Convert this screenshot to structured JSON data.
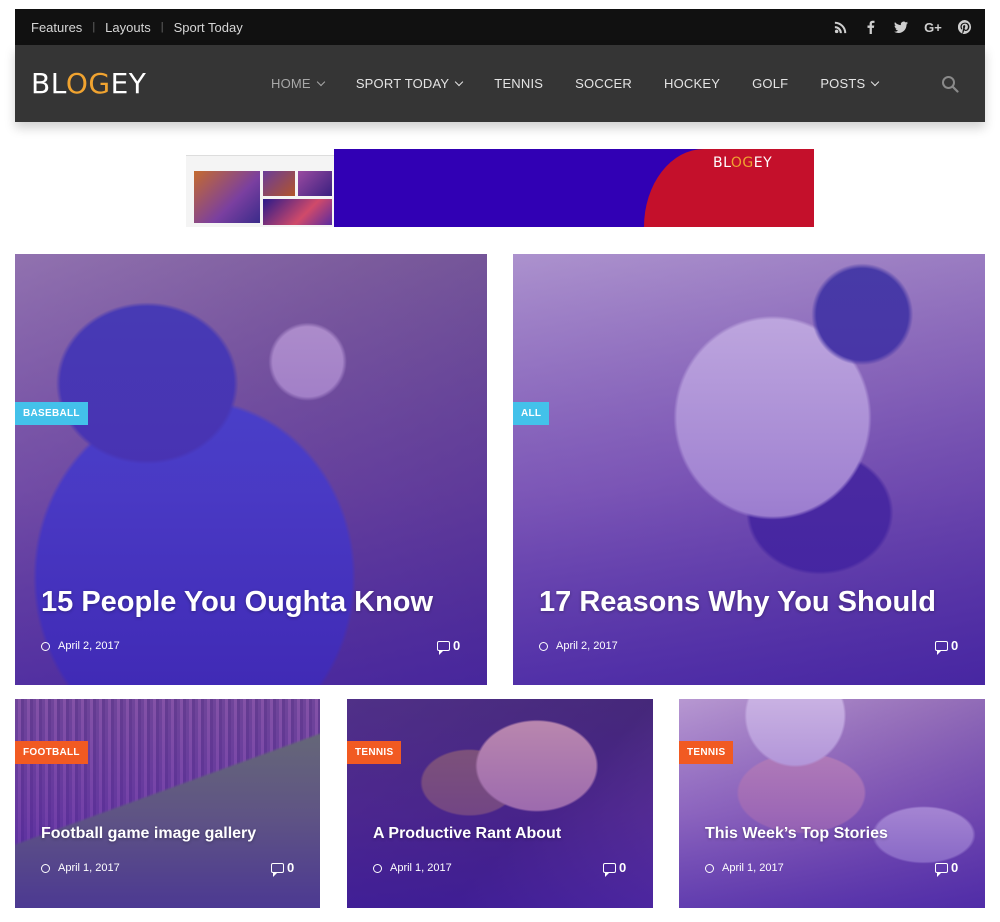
{
  "topbar": {
    "links": [
      "Features",
      "Layouts",
      "Sport Today"
    ],
    "socials": [
      "rss-icon",
      "facebook-icon",
      "twitter-icon",
      "google-plus-icon",
      "pinterest-icon"
    ]
  },
  "header": {
    "logo_prefix": "BL",
    "logo_highlight": "OG",
    "logo_suffix": "EY",
    "menu": [
      {
        "label": "HOME",
        "dropdown": true,
        "active": true
      },
      {
        "label": "SPORT TODAY",
        "dropdown": true
      },
      {
        "label": "TENNIS"
      },
      {
        "label": "SOCCER"
      },
      {
        "label": "HOCKEY"
      },
      {
        "label": "GOLF"
      },
      {
        "label": "POSTS",
        "dropdown": true
      }
    ]
  },
  "banner": {
    "logo_prefix": "BL",
    "logo_highlight": "OG",
    "logo_suffix": "EY"
  },
  "posts": [
    {
      "category": "BASEBALL",
      "badge_color": "#43c1ea",
      "title": "15 People You Oughta Know",
      "date": "April 2, 2017",
      "comments": "0"
    },
    {
      "category": "ALL",
      "badge_color": "#43c1ea",
      "title": "17 Reasons Why You Should",
      "date": "April 2, 2017",
      "comments": "0"
    },
    {
      "category": "FOOTBALL",
      "badge_color": "#f15a22",
      "title": "Football game image gallery",
      "date": "April 1, 2017",
      "comments": "0"
    },
    {
      "category": "TENNIS",
      "badge_color": "#f15a22",
      "title": "A Productive Rant About",
      "date": "April 1, 2017",
      "comments": "0"
    },
    {
      "category": "TENNIS",
      "badge_color": "#f15a22",
      "title": "This Week’s Top Stories",
      "date": "April 1, 2017",
      "comments": "0"
    }
  ],
  "colors": {
    "accent_orange": "#f0a330",
    "badge_blue": "#43c1ea",
    "badge_orange": "#f15a22",
    "nav_bg": "#353535",
    "topbar_bg": "#111111"
  }
}
